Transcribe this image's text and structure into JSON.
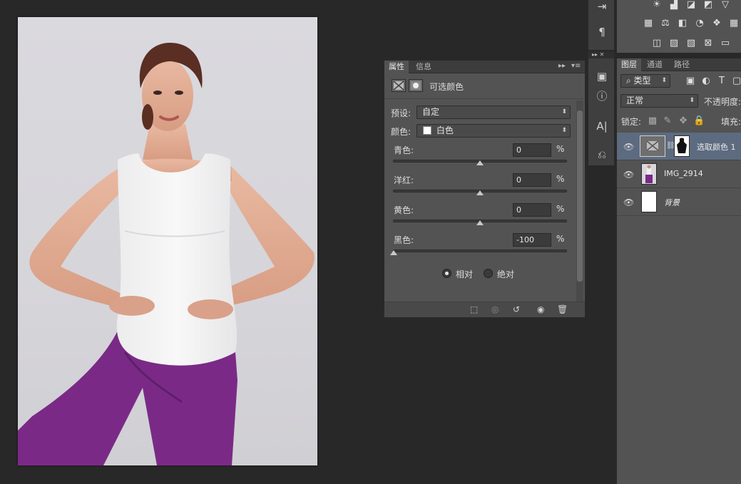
{
  "properties_panel": {
    "tabs": [
      "属性",
      "信息"
    ],
    "title": "可选颜色",
    "preset": {
      "label": "预设:",
      "value": "自定"
    },
    "colors": {
      "label": "颜色:",
      "value": "白色",
      "swatch": "#ffffff"
    },
    "sliders": [
      {
        "label": "青色:",
        "value": "0",
        "unit": "%",
        "level": 0
      },
      {
        "label": "洋红:",
        "value": "0",
        "unit": "%",
        "level": 0
      },
      {
        "label": "黄色:",
        "value": "0",
        "unit": "%",
        "level": 0
      },
      {
        "label": "黑色:",
        "value": "-100",
        "unit": "%",
        "level": -100
      }
    ],
    "method": {
      "relative": "相对",
      "absolute": "绝对",
      "selected": "relative"
    }
  },
  "layers_panel": {
    "tabs": [
      "图层",
      "通道",
      "路径"
    ],
    "filter_kind": "类型",
    "blend_mode": "正常",
    "opacity_label": "不透明度:",
    "lock_label": "锁定:",
    "fill_label": "填充:",
    "layers": [
      {
        "name": "选取颜色 1",
        "selected": true
      },
      {
        "name": "IMG_2914",
        "selected": false
      },
      {
        "name": "背景",
        "selected": false
      }
    ]
  },
  "icons": {
    "eye": "eye-icon",
    "paragraph": "paragraph-icon",
    "info": "info-icon",
    "character": "character-icon"
  },
  "colors": {
    "panel_bg": "#535353",
    "selected_layer": "#5d6b80",
    "pants": "#7a2a86"
  }
}
